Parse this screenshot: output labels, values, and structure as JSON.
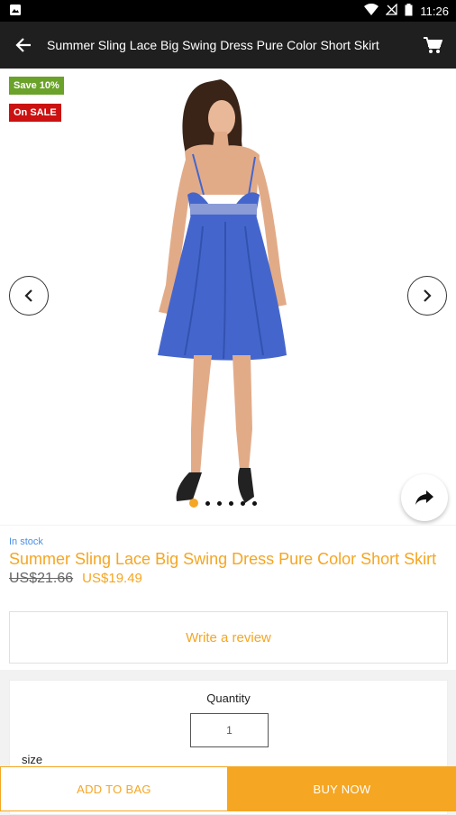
{
  "status_bar": {
    "time": "11:26"
  },
  "app_bar": {
    "title": "Summer Sling Lace Big Swing Dress Pure Color Short Skirt"
  },
  "gallery": {
    "badges": {
      "save": "Save 10%",
      "sale": "On SALE"
    },
    "dots_count": 6,
    "active_dot": 0
  },
  "product": {
    "stock": "In stock",
    "title": "Summer Sling Lace Big Swing Dress Pure Color Short Skirt",
    "old_price": "US$21.66",
    "new_price": "US$19.49"
  },
  "review": {
    "label": "Write a review"
  },
  "quantity": {
    "label": "Quantity",
    "value": "1"
  },
  "size": {
    "label": "size"
  },
  "actions": {
    "add_to_bag": "ADD TO BAG",
    "buy_now": "BUY NOW"
  },
  "colors": {
    "accent": "#f5a623",
    "dress": "#4466cc",
    "save_badge": "#6aa22a",
    "sale_badge": "#cc1111"
  }
}
